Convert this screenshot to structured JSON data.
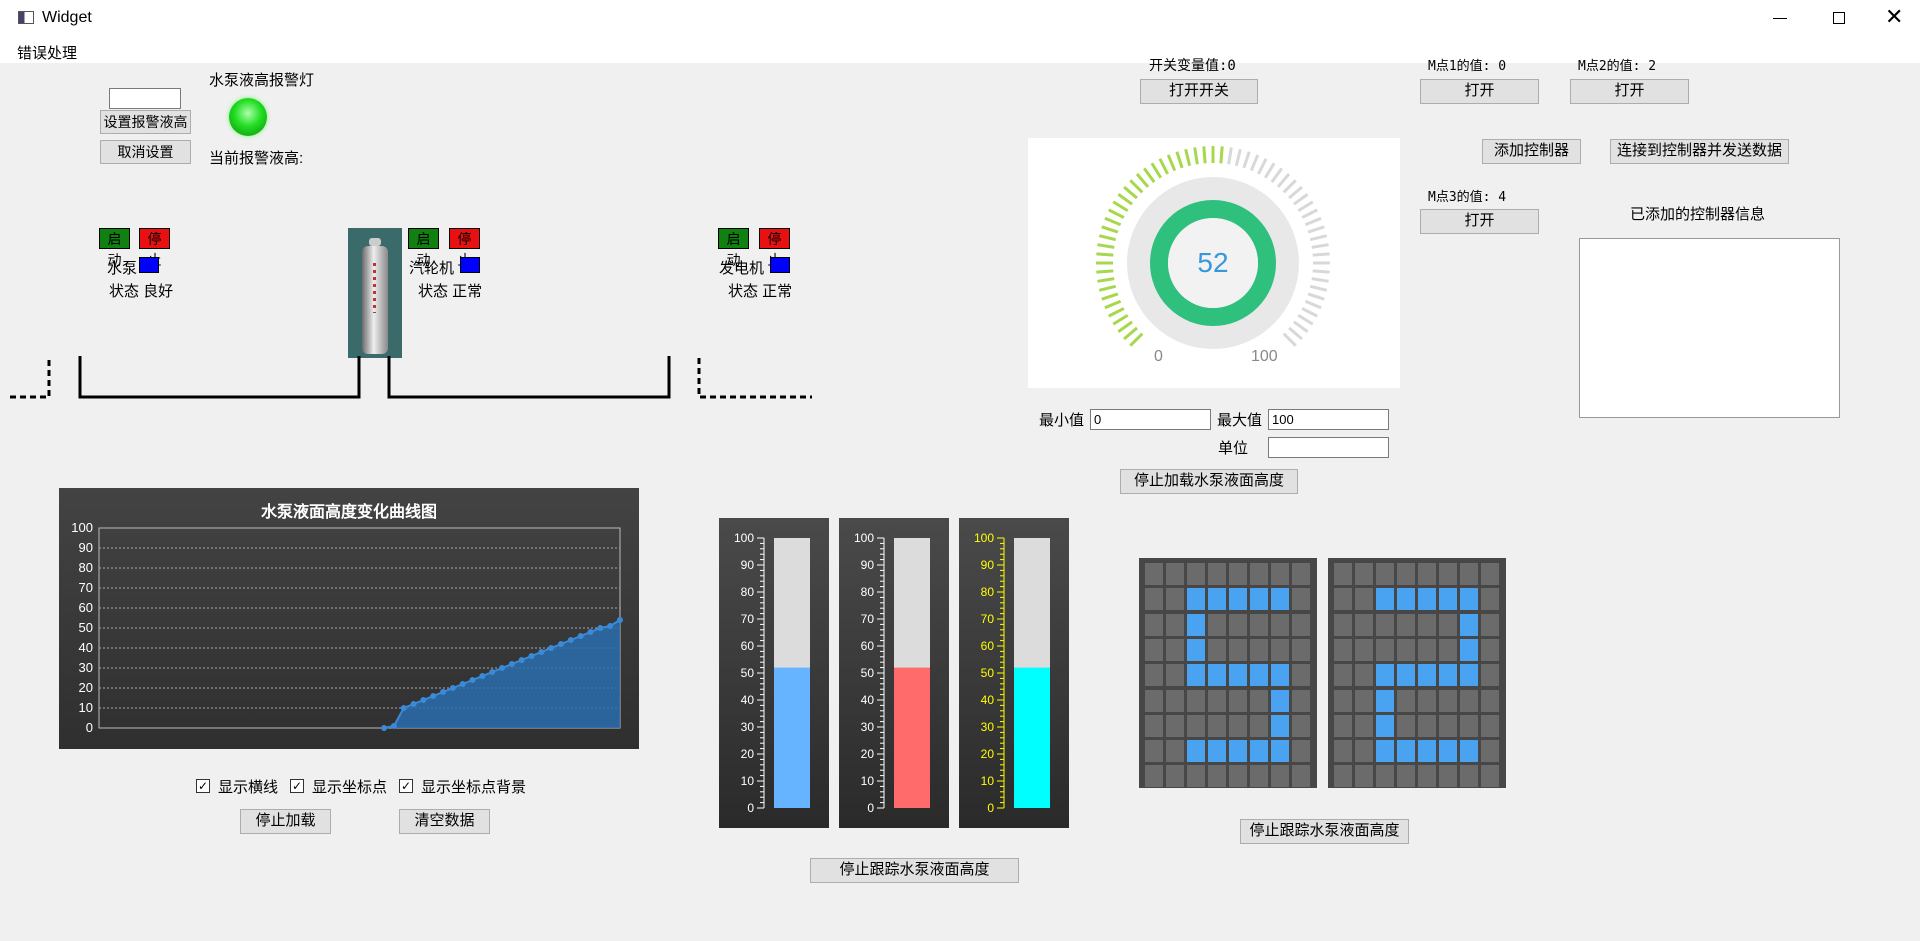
{
  "window": {
    "title": "Widget"
  },
  "menu": [
    "错误处理"
  ],
  "alarm": {
    "input_value": "",
    "set_button": "设置报警液高",
    "cancel_button": "取消设置",
    "lamp_label": "水泵液高报警灯",
    "current_label": "当前报警液高:",
    "lamp_color": "#22dd22"
  },
  "devices": [
    {
      "start": "启动",
      "stop": "停止",
      "name": "水泵",
      "status": "状态 良好"
    },
    {
      "start": "启动",
      "stop": "停止",
      "name": "汽轮机",
      "status": "状态 正常"
    },
    {
      "start": "启动",
      "stop": "停止",
      "name": "发电机",
      "status": "状态 正常"
    }
  ],
  "switch": {
    "label": "开关变量值:0",
    "button": "打开开关"
  },
  "mpoints": [
    {
      "label": "M点1的值: 0",
      "button": "打开"
    },
    {
      "label": "M点2的值: 2",
      "button": "打开"
    },
    {
      "label": "M点3的值: 4",
      "button": "打开"
    }
  ],
  "controller": {
    "add_button": "添加控制器",
    "connect_button": "连接到控制器并发送数据",
    "info_label": "已添加的控制器信息"
  },
  "gauge": {
    "value": "52",
    "min_label": "0",
    "max_label": "100",
    "value_num": 52,
    "color_active": "#a6d84b",
    "color_inactive": "#d8d8d8",
    "ring_color": "#2fc07e",
    "text_color": "#3598db"
  },
  "range": {
    "min_label": "最小值",
    "min_value": "0",
    "max_label": "最大值",
    "max_value": "100",
    "unit_label": "单位",
    "unit_value": "",
    "stop_button": "停止加载水泵液面高度"
  },
  "chart_data": {
    "type": "area",
    "title": "水泵液面高度变化曲线图",
    "ylim": [
      0,
      100
    ],
    "yticks": [
      "100",
      "90",
      "80",
      "70",
      "60",
      "50",
      "40",
      "30",
      "20",
      "10",
      "0"
    ],
    "x": [
      0,
      1,
      2,
      3,
      4,
      5,
      6,
      7,
      8,
      9,
      10,
      11,
      12,
      13,
      14,
      15,
      16,
      17,
      18,
      19,
      20,
      21,
      22,
      23,
      24,
      25,
      26,
      27,
      28,
      29,
      30,
      31,
      32,
      33,
      34,
      35,
      36,
      37,
      38,
      39,
      40,
      41,
      42,
      43,
      44,
      45,
      46,
      47,
      48,
      49,
      50,
      51,
      52,
      53
    ],
    "values": [
      0,
      0,
      0,
      0,
      0,
      0,
      0,
      0,
      0,
      0,
      0,
      0,
      0,
      0,
      0,
      0,
      0,
      0,
      0,
      0,
      0,
      0,
      0,
      0,
      0,
      0,
      0,
      0,
      0,
      0,
      1,
      10,
      12,
      14,
      16,
      18,
      20,
      22,
      24,
      26,
      28,
      30,
      32,
      34,
      36,
      38,
      40,
      42,
      44,
      46,
      48,
      50,
      51,
      54
    ],
    "color": "#2a6cae"
  },
  "chart_options": [
    {
      "label": "显示横线",
      "checked": "✓"
    },
    {
      "label": "显示坐标点",
      "checked": "✓"
    },
    {
      "label": "显示坐标点背景",
      "checked": "✓"
    }
  ],
  "chart_buttons": {
    "stop": "停止加载",
    "clear": "清空数据"
  },
  "thermometers": {
    "ticks": [
      "100",
      "90",
      "80",
      "70",
      "60",
      "50",
      "40",
      "30",
      "20",
      "10",
      "0"
    ],
    "level": 52,
    "items": [
      {
        "fill": "#66b3ff",
        "tick_color": "#ffffff"
      },
      {
        "fill": "#ff6b6b",
        "tick_color": "#ffffff"
      },
      {
        "fill": "#00ffff",
        "tick_color": "#ffff00"
      }
    ],
    "stop_button": "停止跟踪水泵液面高度"
  },
  "led_display": {
    "digits": "52",
    "on_color": "#4aa3f0",
    "off_color": "#6b6b6b",
    "stop_button": "停止跟踪水泵液面高度"
  }
}
